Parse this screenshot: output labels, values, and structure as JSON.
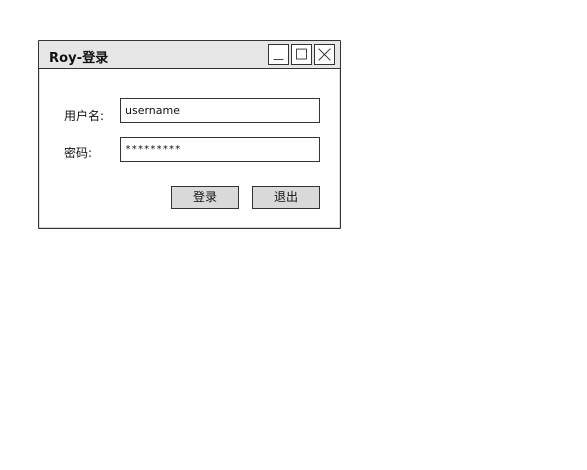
{
  "window": {
    "title": "Roy-登录",
    "controls": {
      "minimize_icon": "minimize-icon",
      "maximize_icon": "maximize-icon",
      "close_icon": "close-icon"
    }
  },
  "form": {
    "username_label": "用户名:",
    "password_label": "密码:",
    "username_value": "username",
    "password_value": "*********"
  },
  "buttons": {
    "login": "登录",
    "exit": "退出"
  },
  "colors": {
    "window_bg": "#ffffff",
    "titlebar_bg": "#e6e6e6",
    "button_bg": "#d9d9d9",
    "border": "#333333"
  }
}
